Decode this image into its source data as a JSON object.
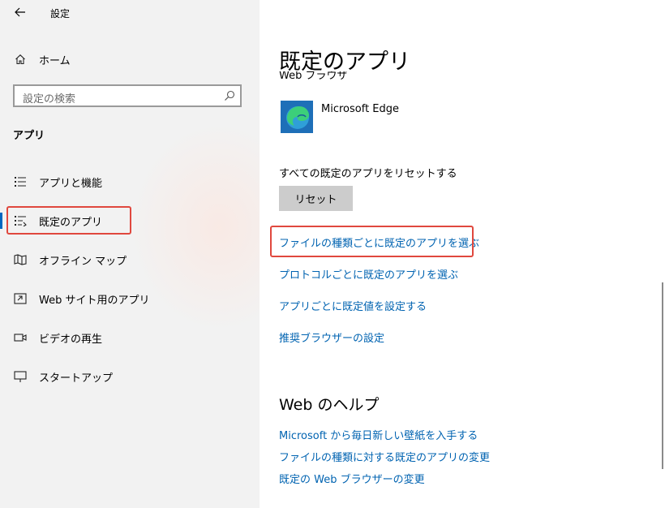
{
  "window": {
    "title": "設定",
    "controls": [
      "minimize-icon",
      "maximize-icon",
      "close-icon"
    ]
  },
  "sidebar": {
    "home_label": "ホーム",
    "search_placeholder": "設定の検索",
    "section_title": "アプリ",
    "items": [
      {
        "label": "アプリと機能",
        "icon": "apps-features-icon"
      },
      {
        "label": "既定のアプリ",
        "icon": "default-apps-icon",
        "selected": true
      },
      {
        "label": "オフライン マップ",
        "icon": "offline-maps-icon"
      },
      {
        "label": "Web サイト用のアプリ",
        "icon": "apps-for-websites-icon"
      },
      {
        "label": "ビデオの再生",
        "icon": "video-playback-icon"
      },
      {
        "label": "スタートアップ",
        "icon": "startup-icon"
      }
    ]
  },
  "main": {
    "title": "既定のアプリ",
    "web_browser_label": "Web ブラウザ",
    "browser_name": "Microsoft Edge",
    "reset_label": "すべての既定のアプリをリセットする",
    "reset_button": "リセット",
    "links": [
      "ファイルの種類ごとに既定のアプリを選ぶ",
      "プロトコルごとに既定のアプリを選ぶ",
      "アプリごとに既定値を設定する",
      "推奨ブラウザーの設定"
    ],
    "help_title": "Web のヘルプ",
    "help_links": [
      "Microsoft から毎日新しい壁紙を入手する",
      "ファイルの種類に対する既定のアプリの変更",
      "既定の Web ブラウザーの変更"
    ]
  },
  "colors": {
    "accent": "#0067c0",
    "link": "#0063b1",
    "highlight_box": "#e0483e",
    "sidebar_bg": "#f2f2f2"
  }
}
